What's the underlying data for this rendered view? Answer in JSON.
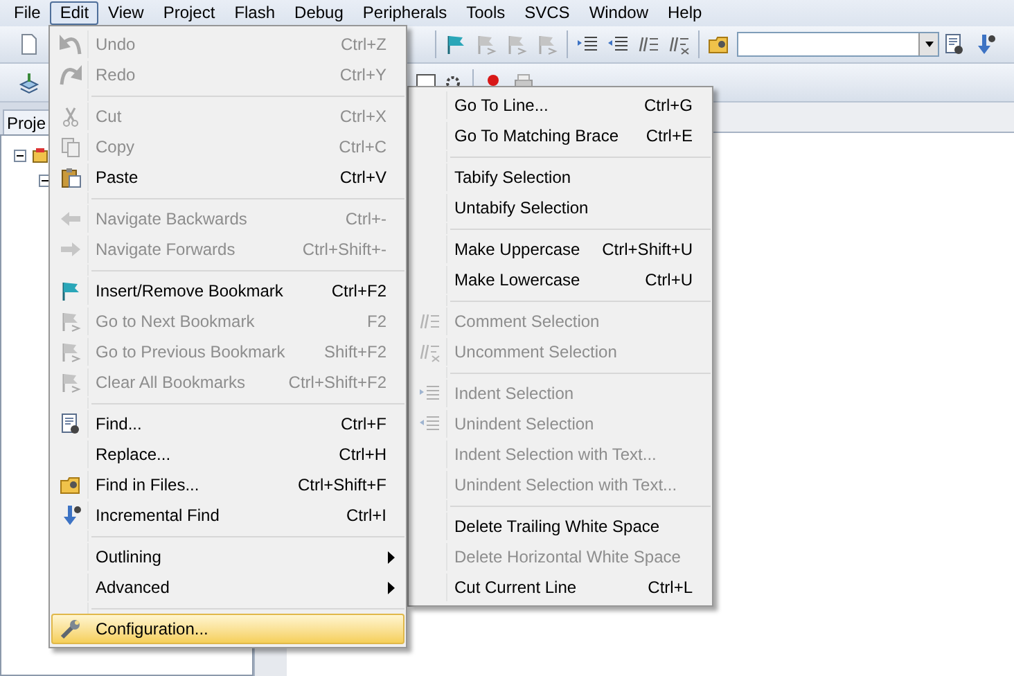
{
  "menubar": [
    {
      "label": "File",
      "selected": false
    },
    {
      "label": "Edit",
      "selected": true
    },
    {
      "label": "View",
      "selected": false
    },
    {
      "label": "Project",
      "selected": false
    },
    {
      "label": "Flash",
      "selected": false
    },
    {
      "label": "Debug",
      "selected": false
    },
    {
      "label": "Peripherals",
      "selected": false
    },
    {
      "label": "Tools",
      "selected": false
    },
    {
      "label": "SVCS",
      "selected": false
    },
    {
      "label": "Window",
      "selected": false
    },
    {
      "label": "Help",
      "selected": false
    }
  ],
  "project_panel": {
    "tab": "Proje",
    "tree": [
      {
        "expanded": true,
        "children": [
          {
            "expanded": true
          }
        ]
      }
    ]
  },
  "edit_menu": {
    "items": [
      {
        "kind": "item",
        "label": "Undo",
        "shortcut": "Ctrl+Z",
        "disabled": true,
        "selected": false
      },
      {
        "kind": "item",
        "label": "Redo",
        "shortcut": "Ctrl+Y",
        "disabled": true,
        "selected": false
      },
      {
        "kind": "separator"
      },
      {
        "kind": "item",
        "label": "Cut",
        "shortcut": "Ctrl+X",
        "disabled": true,
        "selected": false
      },
      {
        "kind": "item",
        "label": "Copy",
        "shortcut": "Ctrl+C",
        "disabled": true,
        "selected": false
      },
      {
        "kind": "item",
        "label": "Paste",
        "shortcut": "Ctrl+V",
        "disabled": false,
        "selected": false
      },
      {
        "kind": "separator"
      },
      {
        "kind": "item",
        "label": "Navigate Backwards",
        "shortcut": "Ctrl+-",
        "disabled": true,
        "selected": false
      },
      {
        "kind": "item",
        "label": "Navigate Forwards",
        "shortcut": "Ctrl+Shift+-",
        "disabled": true,
        "selected": false
      },
      {
        "kind": "separator"
      },
      {
        "kind": "item",
        "label": "Insert/Remove Bookmark",
        "shortcut": "Ctrl+F2",
        "disabled": false,
        "selected": false
      },
      {
        "kind": "item",
        "label": "Go to Next Bookmark",
        "shortcut": "F2",
        "disabled": true,
        "selected": false
      },
      {
        "kind": "item",
        "label": "Go to Previous Bookmark",
        "shortcut": "Shift+F2",
        "disabled": true,
        "selected": false
      },
      {
        "kind": "item",
        "label": "Clear All Bookmarks",
        "shortcut": "Ctrl+Shift+F2",
        "disabled": true,
        "selected": false
      },
      {
        "kind": "separator"
      },
      {
        "kind": "item",
        "label": "Find...",
        "shortcut": "Ctrl+F",
        "disabled": false,
        "selected": false
      },
      {
        "kind": "item",
        "label": "Replace...",
        "shortcut": "Ctrl+H",
        "disabled": false,
        "selected": false
      },
      {
        "kind": "item",
        "label": "Find in Files...",
        "shortcut": "Ctrl+Shift+F",
        "disabled": false,
        "selected": false
      },
      {
        "kind": "item",
        "label": "Incremental Find",
        "shortcut": "Ctrl+I",
        "disabled": false,
        "selected": false
      },
      {
        "kind": "separator"
      },
      {
        "kind": "submenu",
        "label": "Outlining",
        "disabled": false,
        "selected": false
      },
      {
        "kind": "submenu",
        "label": "Advanced",
        "disabled": false,
        "selected": false
      },
      {
        "kind": "separator"
      },
      {
        "kind": "item",
        "label": "Configuration...",
        "disabled": false,
        "selected": true
      }
    ]
  },
  "advanced_menu": {
    "items": [
      {
        "kind": "item",
        "label": "Go To Line...",
        "shortcut": "Ctrl+G",
        "disabled": false
      },
      {
        "kind": "item",
        "label": "Go To Matching Brace",
        "shortcut": "Ctrl+E",
        "disabled": false
      },
      {
        "kind": "separator"
      },
      {
        "kind": "item",
        "label": "Tabify Selection",
        "disabled": false
      },
      {
        "kind": "item",
        "label": "Untabify Selection",
        "disabled": false
      },
      {
        "kind": "separator"
      },
      {
        "kind": "item",
        "label": "Make Uppercase",
        "shortcut": "Ctrl+Shift+U",
        "disabled": false
      },
      {
        "kind": "item",
        "label": "Make Lowercase",
        "shortcut": "Ctrl+U",
        "disabled": false
      },
      {
        "kind": "separator"
      },
      {
        "kind": "item",
        "label": "Comment Selection",
        "disabled": true
      },
      {
        "kind": "item",
        "label": "Uncomment Selection",
        "disabled": true
      },
      {
        "kind": "separator"
      },
      {
        "kind": "item",
        "label": "Indent Selection",
        "disabled": true
      },
      {
        "kind": "item",
        "label": "Unindent Selection",
        "disabled": true
      },
      {
        "kind": "item",
        "label": "Indent Selection with Text...",
        "disabled": true
      },
      {
        "kind": "item",
        "label": "Unindent Selection with Text...",
        "disabled": true
      },
      {
        "kind": "separator"
      },
      {
        "kind": "item",
        "label": "Delete Trailing White Space",
        "disabled": false
      },
      {
        "kind": "item",
        "label": "Delete Horizontal White Space",
        "disabled": true
      },
      {
        "kind": "item",
        "label": "Cut Current Line",
        "shortcut": "Ctrl+L",
        "disabled": false
      }
    ]
  }
}
